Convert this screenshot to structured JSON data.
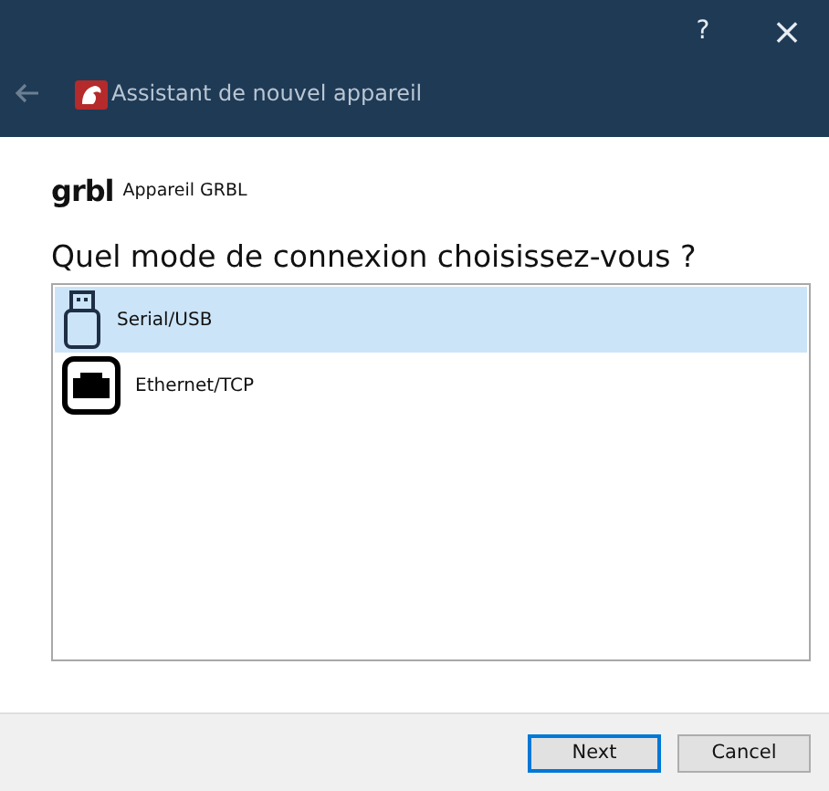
{
  "window": {
    "title": "Assistant de nouvel appareil",
    "help": "?",
    "close": "×"
  },
  "device": {
    "logo": "grbl",
    "name": "Appareil GRBL"
  },
  "question": "Quel mode de connexion choisissez-vous ?",
  "options": [
    {
      "kind": "usb",
      "label": "Serial/USB",
      "selected": true
    },
    {
      "kind": "ethernet",
      "label": "Ethernet/TCP",
      "selected": false
    }
  ],
  "buttons": [
    {
      "label": "Next",
      "default": true
    },
    {
      "label": "Cancel",
      "default": false
    }
  ]
}
